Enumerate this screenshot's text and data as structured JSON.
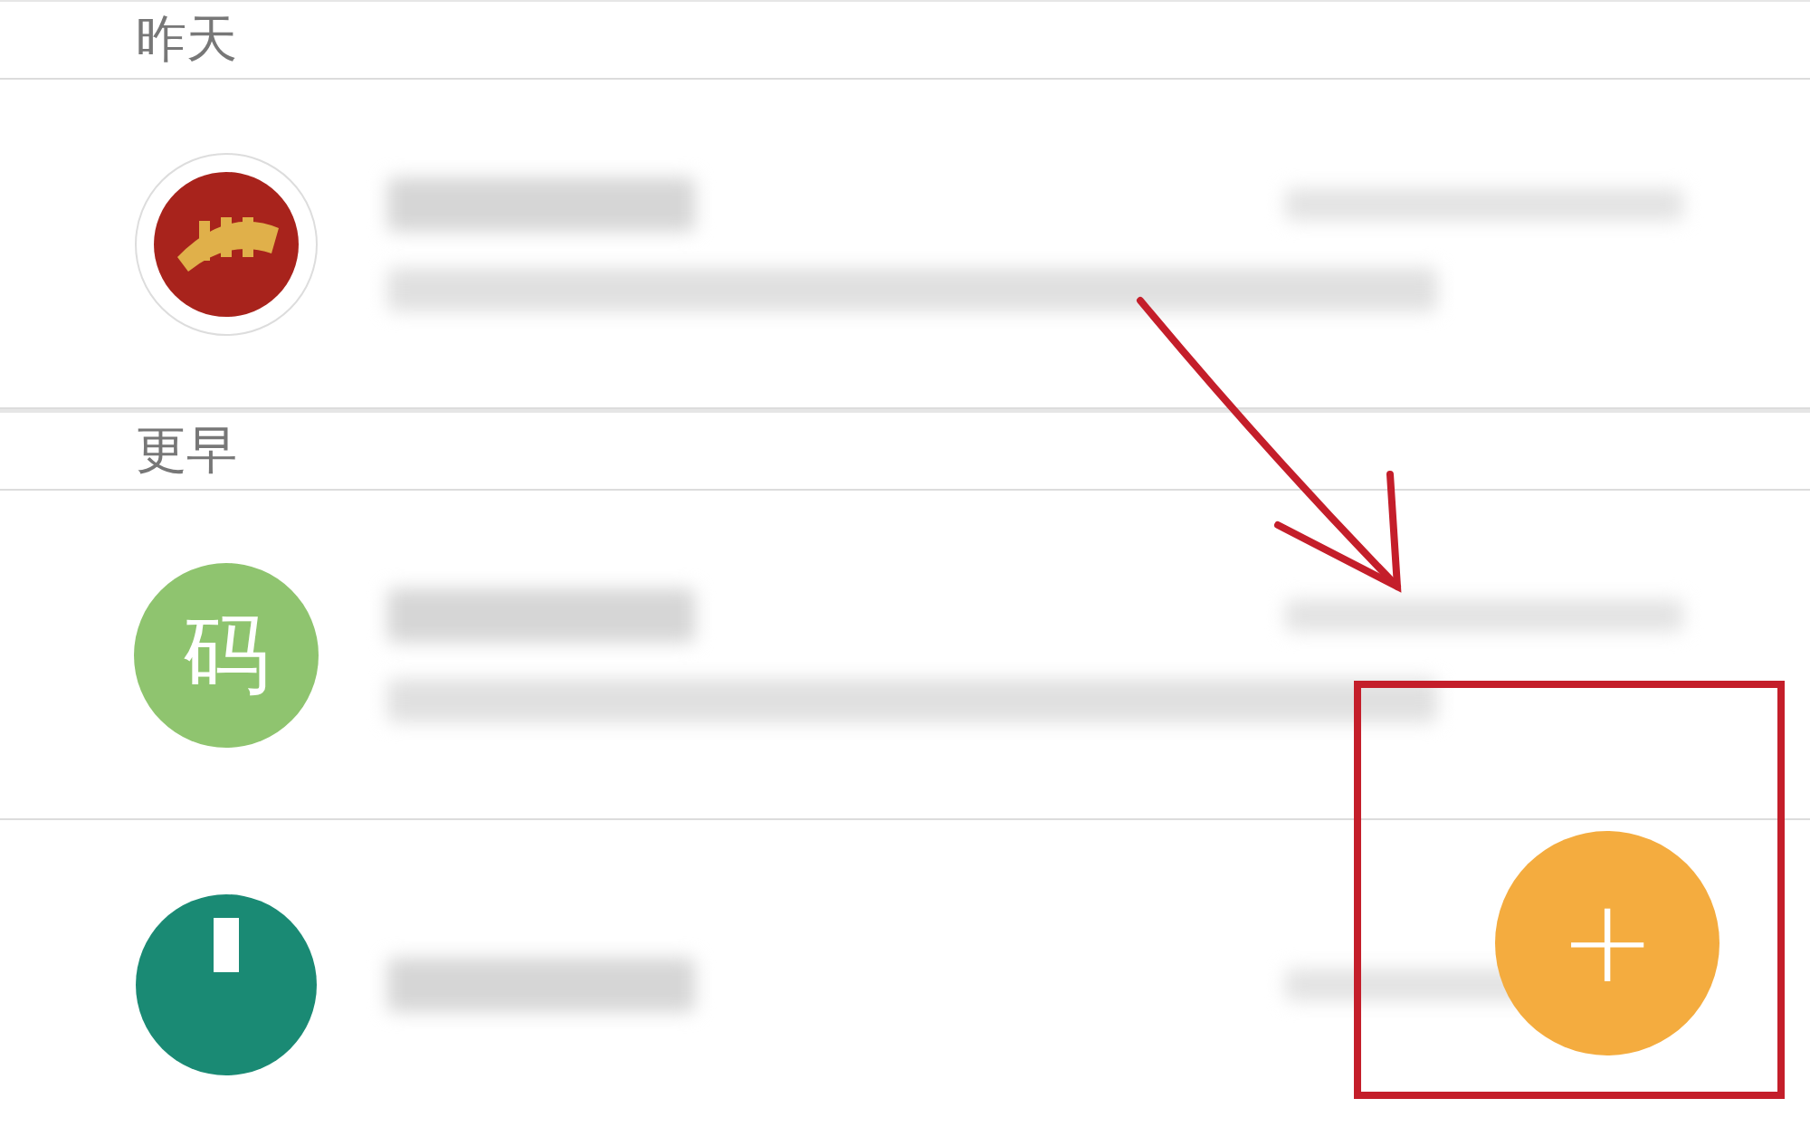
{
  "sections": [
    {
      "header": "昨天",
      "items": [
        {
          "avatar": {
            "kind": "logo"
          }
        }
      ]
    },
    {
      "header": "更早",
      "items": [
        {
          "avatar": {
            "kind": "letter",
            "text": "码",
            "color": "#8fc46f"
          }
        },
        {
          "avatar": {
            "kind": "emblem",
            "color": "#1a8a74"
          }
        }
      ]
    }
  ],
  "fab": {
    "label": "+"
  },
  "annotation": {
    "kind": "arrow-and-box"
  }
}
